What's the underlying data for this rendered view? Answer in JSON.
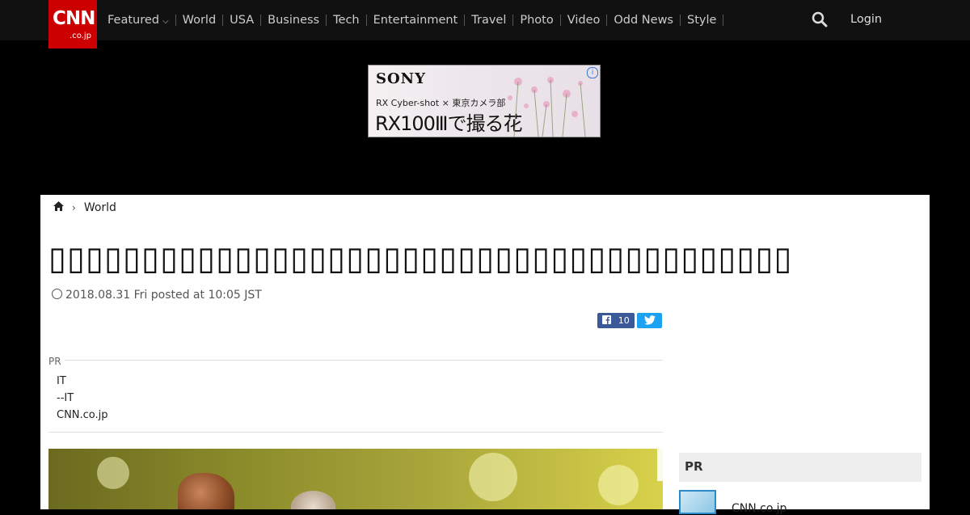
{
  "header": {
    "logo_main": "CNN",
    "logo_sub": ".co.jp",
    "nav": [
      {
        "label": "Featured",
        "dropdown": true
      },
      {
        "label": "World"
      },
      {
        "label": "USA"
      },
      {
        "label": "Business"
      },
      {
        "label": "Tech"
      },
      {
        "label": "Entertainment"
      },
      {
        "label": "Travel"
      },
      {
        "label": "Photo"
      },
      {
        "label": "Video"
      },
      {
        "label": "Odd News"
      },
      {
        "label": "Style"
      }
    ],
    "login": "Login",
    "search_icon": "search-icon"
  },
  "ad": {
    "brand": "SONY",
    "subline": "RX Cyber-shot × 東京カメラ部",
    "headline": "RX100Ⅲで撮る花",
    "info_glyph": "i"
  },
  "article": {
    "breadcrumb": [
      "World"
    ],
    "title": "▯▯▯▯▯▯▯▯▯▯▯▯▯▯▯▯▯▯▯▯▯▯▯▯▯▯▯▯▯▯▯▯▯▯▯▯▯▯▯▯",
    "date": "2018.08.31 Fri posted at 10:05 JST",
    "fb_count": "10"
  },
  "pr_block": {
    "label": "PR",
    "items": [
      "IT",
      "--IT",
      "CNN.co.jp"
    ]
  },
  "sidebar": {
    "pr_title": "PR",
    "item_text": "CNN.co.jp"
  },
  "colors": {
    "brand_red": "#cc0000",
    "facebook": "#3b5998",
    "twitter": "#1da1f2"
  }
}
